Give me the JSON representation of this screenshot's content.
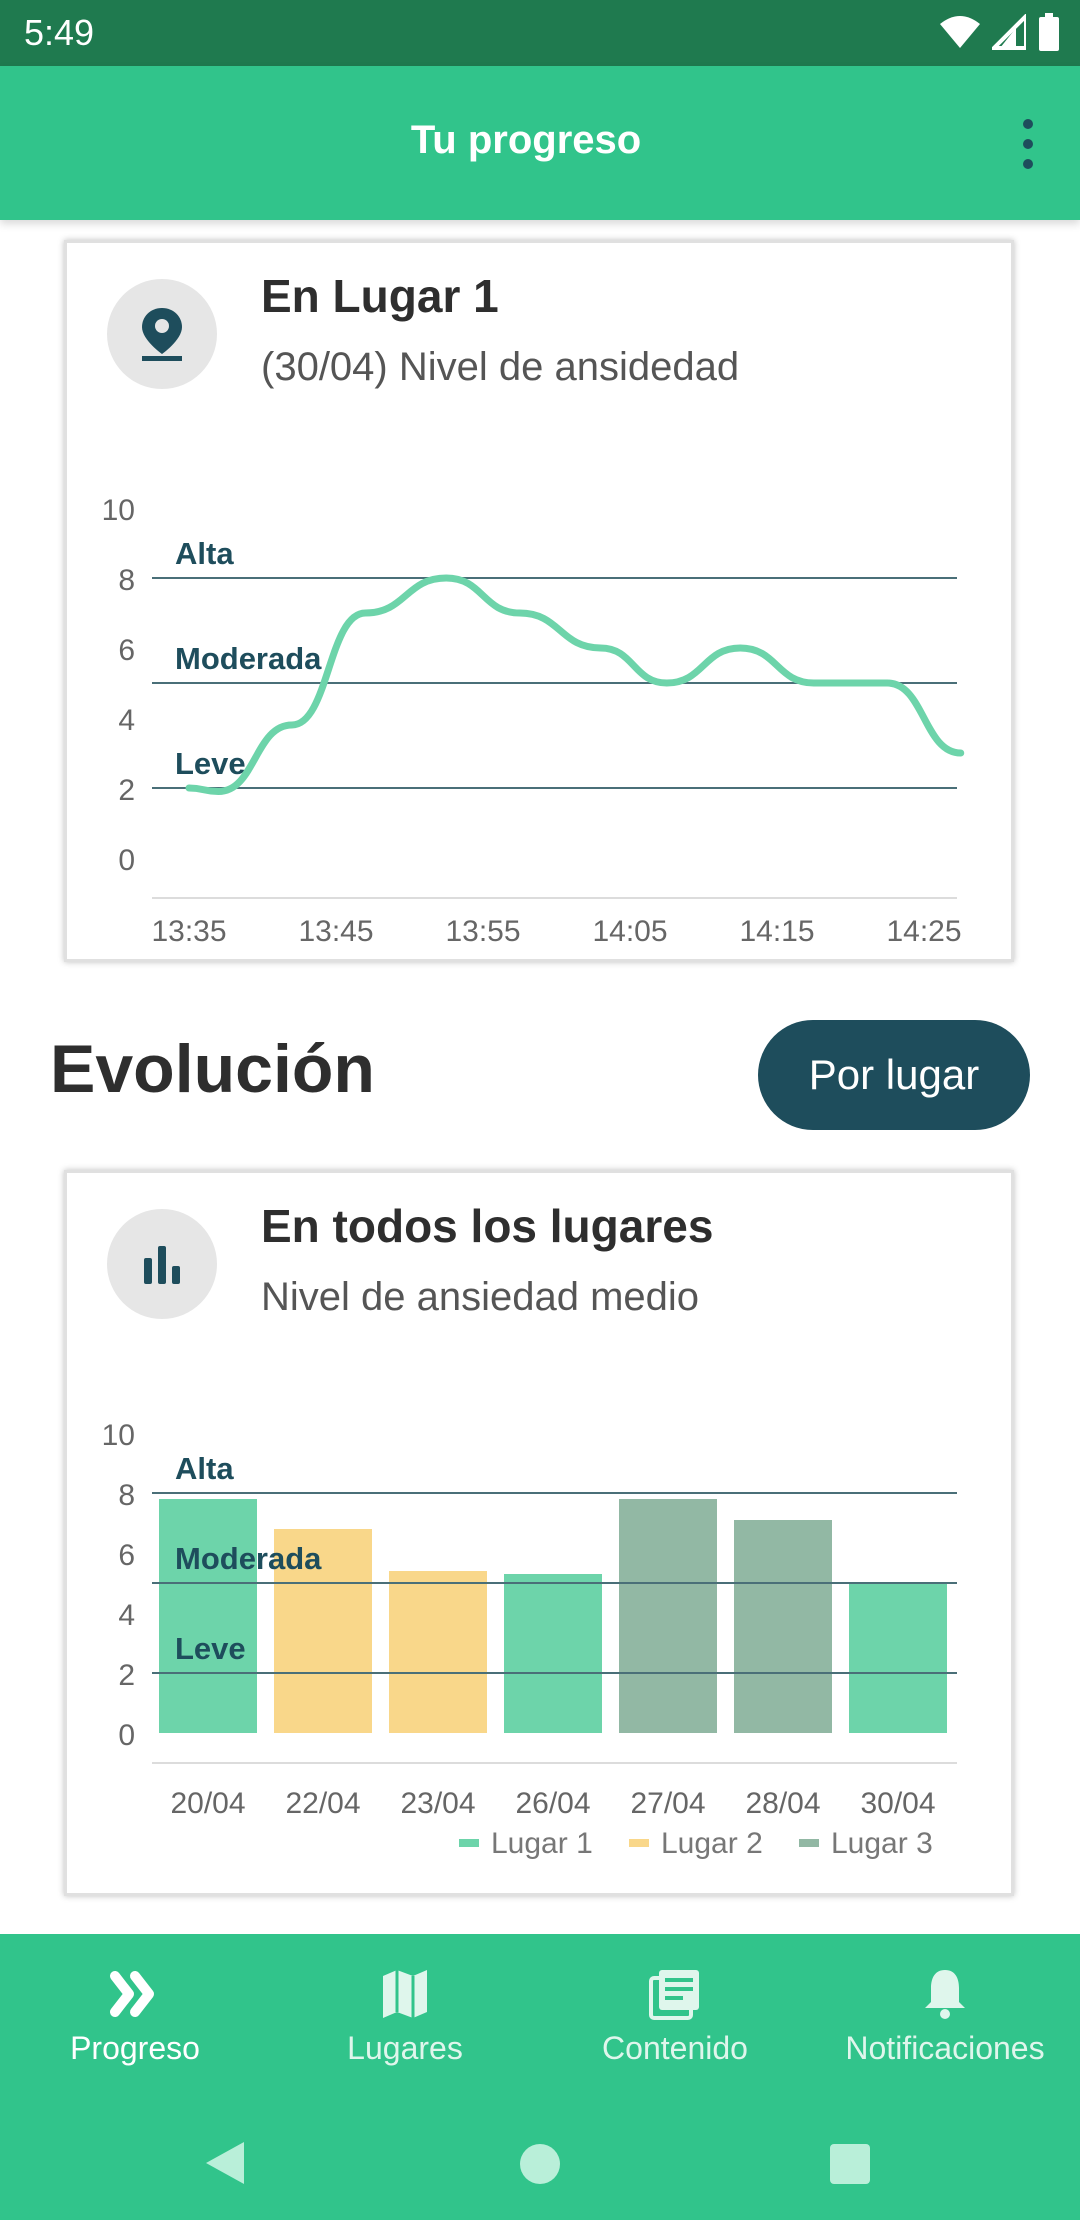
{
  "status_bar": {
    "time": "5:49"
  },
  "app_bar": {
    "title": "Tu progreso",
    "more_icon": "more-vertical-icon"
  },
  "card1": {
    "icon": "location-pin-icon",
    "title": "En Lugar 1",
    "subtitle": "(30/04) Nivel de ansidedad"
  },
  "section": {
    "title": "Evolución",
    "button_label": "Por lugar"
  },
  "card2": {
    "icon": "bar-chart-icon",
    "title": "En todos los lugares",
    "subtitle": "Nivel de ansiedad medio"
  },
  "bottom_nav": [
    {
      "label": "Progreso",
      "icon": "double-chevron-icon",
      "active": true
    },
    {
      "label": "Lugares",
      "icon": "map-icon",
      "active": false
    },
    {
      "label": "Contenido",
      "icon": "articles-icon",
      "active": false
    },
    {
      "label": "Notificaciones",
      "icon": "bell-icon",
      "active": false
    }
  ],
  "colors": {
    "primary": "#31c48b",
    "dark": "#1e4d5c",
    "lugar1": "#6dd4aa",
    "lugar2": "#f9d78a",
    "lugar3": "#92b8a4"
  },
  "chart_data": [
    {
      "type": "line",
      "x": [
        "13:35",
        "13:45",
        "13:55",
        "14:05",
        "14:15",
        "14:25"
      ],
      "ylim": [
        0,
        10
      ],
      "yticks": [
        "0",
        "2",
        "4",
        "6",
        "8",
        "10"
      ],
      "thresholds": [
        {
          "label": "Alta",
          "value": 8
        },
        {
          "label": "Moderada",
          "value": 5
        },
        {
          "label": "Leve",
          "value": 2
        }
      ],
      "series": [
        {
          "values": [
            2.0,
            1.9,
            3.8,
            7.0,
            8.0,
            7.0,
            6.0,
            5.0,
            6.0,
            5.0,
            5.0,
            3.0
          ],
          "x_minutes": [
            0,
            2,
            7,
            12,
            17.5,
            22.5,
            28,
            32.5,
            37.5,
            42.5,
            47.5,
            52.5
          ]
        }
      ],
      "grid": false
    },
    {
      "type": "bar",
      "categories": [
        "20/04",
        "22/04",
        "23/04",
        "26/04",
        "27/04",
        "28/04",
        "30/04"
      ],
      "values": [
        7.8,
        6.8,
        5.4,
        5.3,
        7.8,
        7.1,
        5.0
      ],
      "groups": [
        "Lugar 1",
        "Lugar 2",
        "Lugar 2",
        "Lugar 1",
        "Lugar 3",
        "Lugar 3",
        "Lugar 1"
      ],
      "ylim": [
        0,
        10
      ],
      "yticks": [
        "0",
        "2",
        "4",
        "6",
        "8",
        "10"
      ],
      "thresholds": [
        {
          "label": "Alta",
          "value": 8
        },
        {
          "label": "Moderada",
          "value": 5
        },
        {
          "label": "Leve",
          "value": 2
        }
      ],
      "legend": [
        "Lugar 1",
        "Lugar 2",
        "Lugar 3"
      ],
      "legend_position": "bottom-right"
    }
  ]
}
